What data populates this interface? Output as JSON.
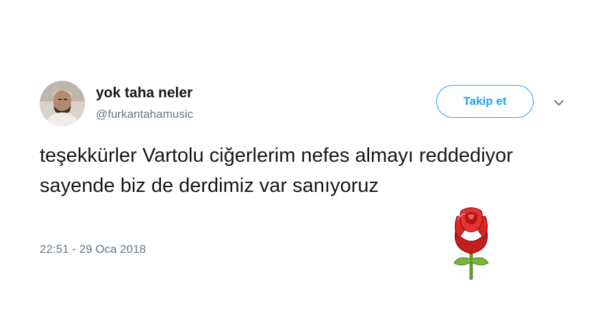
{
  "tweet": {
    "author": {
      "display_name": "yok taha neler",
      "handle": "@furkantahamusic"
    },
    "follow_label": "Takip et",
    "text": "teşekkürler Vartolu ciğerlerim nefes almayı reddediyor sayende biz de derdimiz var sanıyoruz",
    "timestamp": "22:51 - 29 Oca 2018",
    "emoji": "rose-emoji",
    "colors": {
      "accent": "#1da1f2",
      "secondary_text": "#657786",
      "primary_text": "#14171a"
    }
  }
}
